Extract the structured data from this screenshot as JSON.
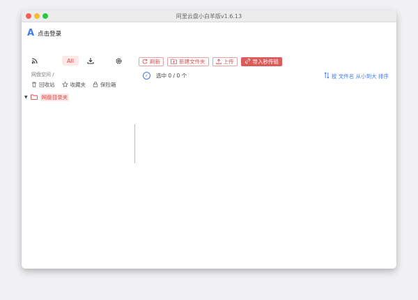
{
  "window": {
    "title": "阿里云盘小白羊版v1.6.13"
  },
  "sidebar": {
    "login_label": "点击登录",
    "filter_badge": "All",
    "storage_label": "网盘空间",
    "storage_sep": "/",
    "quick_links": [
      {
        "label": "回收站",
        "icon": "trash-icon"
      },
      {
        "label": "收藏夹",
        "icon": "star-icon"
      },
      {
        "label": "保险箱",
        "icon": "lock-icon"
      }
    ],
    "tree": {
      "root_label": "网盘目录夹"
    }
  },
  "toolbar": {
    "refresh_label": "刷新",
    "new_folder_label": "新建文件夹",
    "upload_label": "上传",
    "import_label": "导入秒传链"
  },
  "main": {
    "select_text": "选中 0 / 0 个",
    "sort_text": "按 文件名 从小到大 排序"
  },
  "colors": {
    "accent_red": "#dc5b5b",
    "accent_blue": "#3e7bf6"
  }
}
